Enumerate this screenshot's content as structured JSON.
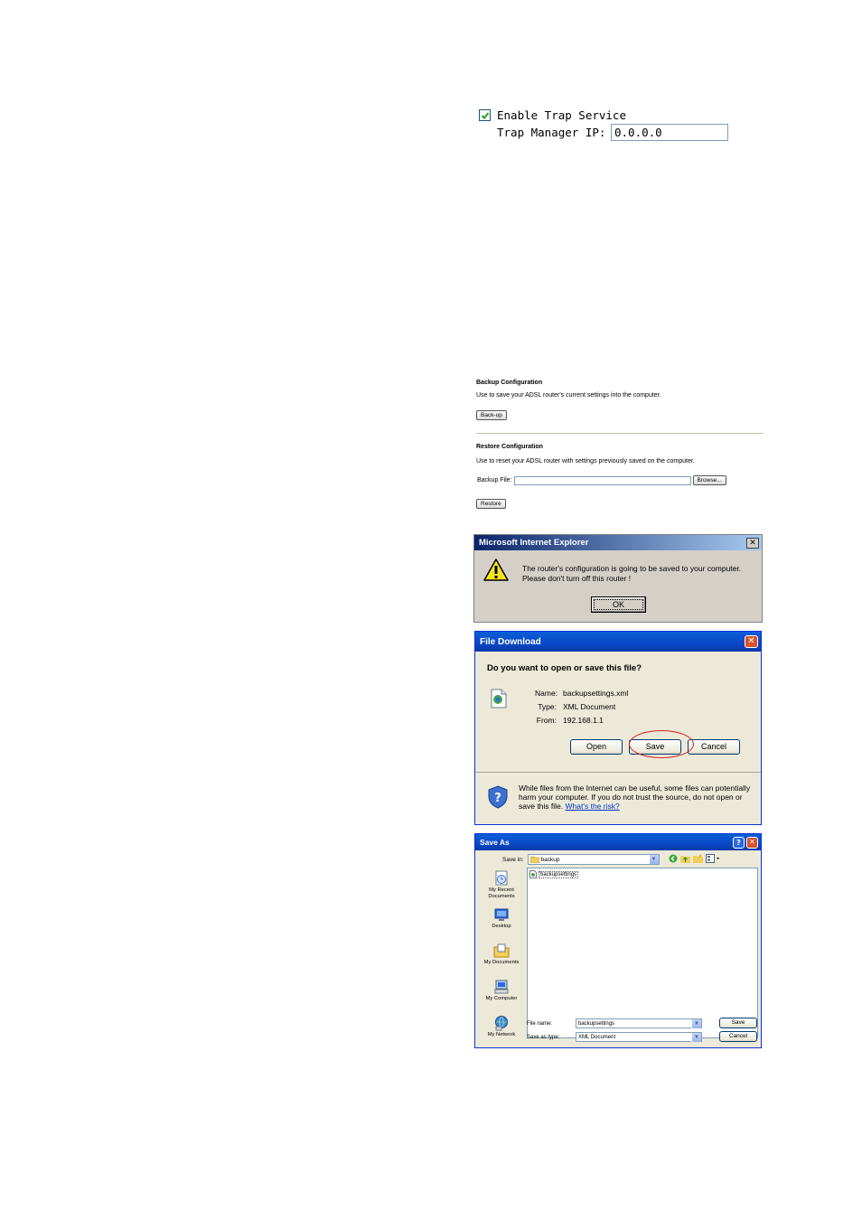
{
  "trap": {
    "enable_label": "Enable Trap Service",
    "enabled": true,
    "manager_label": "Trap Manager IP:",
    "manager_ip": "0.0.0.0"
  },
  "backup": {
    "title": "Backup Configuration",
    "description": "Use to save your ADSL router's current settings into the computer.",
    "button": "Back-up"
  },
  "restore": {
    "title": "Restore Configuration",
    "description": "Use to reset your ADSL router with settings previously saved on the computer.",
    "file_label": "Backup File:",
    "file_value": "",
    "browse_button": "Browse...",
    "restore_button": "Restore"
  },
  "ie_alert": {
    "title": "Microsoft Internet Explorer",
    "message_line1": "The router's configuration is going to be saved to your computer.",
    "message_line2": "Please don't turn off this router !",
    "ok": "OK"
  },
  "file_download": {
    "title": "File Download",
    "question": "Do you want to open or save this file?",
    "name_label": "Name:",
    "name": "backupsettings.xml",
    "type_label": "Type:",
    "type": "XML Document",
    "from_label": "From:",
    "from": "192.168.1.1",
    "open": "Open",
    "save": "Save",
    "cancel": "Cancel",
    "warning_line1": "While files from the Internet can be useful, some files can potentially",
    "warning_line2": "harm your computer. If you do not trust the source, do not open or",
    "warning_line3": "save this file.",
    "risk_link": "What's the risk?"
  },
  "save_as": {
    "title": "Save As",
    "save_in_label": "Save in:",
    "save_in": "backup",
    "places": [
      "My Recent Documents",
      "Desktop",
      "My Documents",
      "My Computer",
      "My Network"
    ],
    "file_item": "backupsettings",
    "file_name_label": "File name:",
    "file_name": "backupsettings",
    "save_type_label": "Save as type:",
    "save_type": "XML Document",
    "save": "Save",
    "cancel": "Cancel"
  },
  "colors": {
    "xp_title_blue": "#0847c5",
    "ie_title_blue": "#0a246a",
    "dialog_bg": "#ece9d8",
    "highlight_ring": "#d42020"
  }
}
